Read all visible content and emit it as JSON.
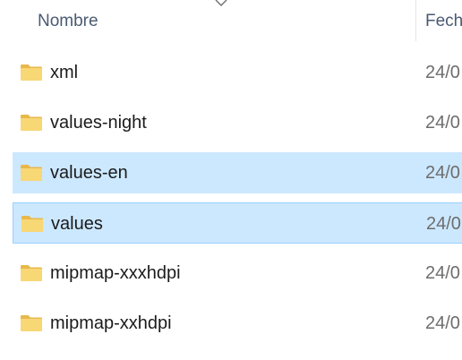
{
  "header": {
    "name_label": "Nombre",
    "date_label": "Fech"
  },
  "icons": {
    "folder": "folder-icon",
    "sort": "chevron-down-icon"
  },
  "colors": {
    "selection": "#cce8ff",
    "focus_border": "#99d1ff",
    "folder_yellow": "#f8d775"
  },
  "rows": [
    {
      "name": "xml",
      "date": "24/0",
      "state": "normal"
    },
    {
      "name": "values-night",
      "date": "24/0",
      "state": "normal"
    },
    {
      "name": "values-en",
      "date": "24/0",
      "state": "selected"
    },
    {
      "name": "values",
      "date": "24/0",
      "state": "focused"
    },
    {
      "name": "mipmap-xxxhdpi",
      "date": "24/0",
      "state": "normal"
    },
    {
      "name": "mipmap-xxhdpi",
      "date": "24/0",
      "state": "normal"
    }
  ]
}
